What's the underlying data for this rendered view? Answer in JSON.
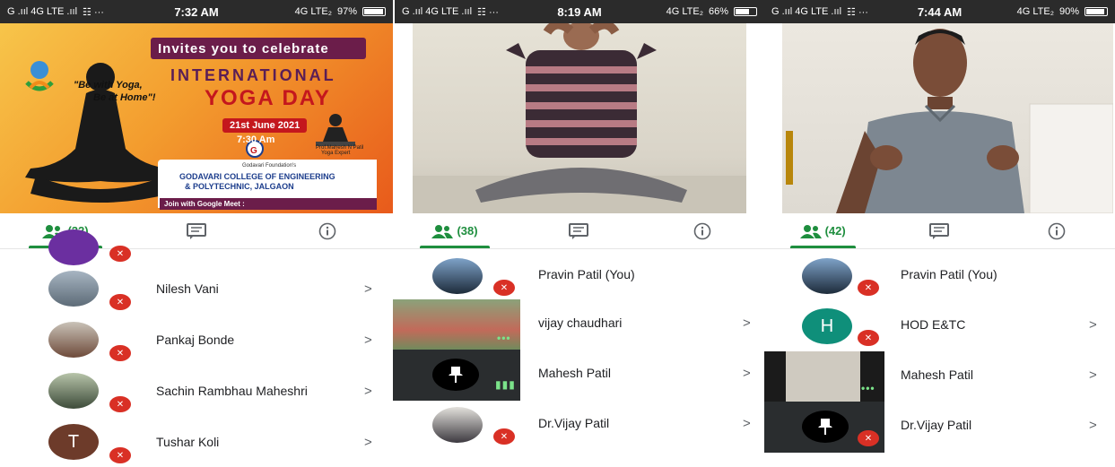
{
  "screens": [
    {
      "status": {
        "signal": "G .ııl 4G LTE .ııl",
        "icons": "☷ ···",
        "time": "7:32 AM",
        "network": "4G LTE₂",
        "battery": "97%",
        "battery_level": 0.97
      },
      "poster": {
        "invites": "Invites you to celebrate",
        "quote_line1": "\"Be with Yoga,",
        "quote_line2": "Be at Home\"!",
        "title_line1": "INTERNATIONAL",
        "title_line2": "YOGA DAY",
        "date": "21st June 2021",
        "time": "7:30 Am",
        "speaker_name": "Prof.Mahesh N Patil",
        "speaker_role": "Yoga Expert",
        "foundation": "Godavari Foundation's",
        "college_line1": "GODAVARI COLLEGE OF ENGINEERING",
        "college_line2": "& POLYTECHNIC, JALGAON",
        "meet": "Join with Google Meet :"
      },
      "tabs": {
        "people_count": "(22)"
      },
      "participants": [
        {
          "name": "Nilesh Vani"
        },
        {
          "name": "Pankaj Bonde"
        },
        {
          "name": "Sachin Rambhau Maheshri"
        },
        {
          "name": "Tushar Koli",
          "initial": "T"
        }
      ]
    },
    {
      "status": {
        "signal": "G .ııl 4G LTE .ııl",
        "icons": "☷ ···",
        "time": "8:19 AM",
        "network": "4G LTE₂",
        "battery": "66%",
        "battery_level": 0.66
      },
      "tabs": {
        "people_count": "(38)"
      },
      "participants": [
        {
          "name": "Pravin Patil (You)"
        },
        {
          "name": "vijay chaudhari"
        },
        {
          "name": "Mahesh Patil"
        },
        {
          "name": "Dr.Vijay Patil"
        }
      ]
    },
    {
      "status": {
        "signal": "G .ııl 4G LTE .ııl",
        "icons": "☷ ···",
        "time": "7:44 AM",
        "network": "4G LTE₂",
        "battery": "90%",
        "battery_level": 0.9
      },
      "tabs": {
        "people_count": "(42)"
      },
      "participants": [
        {
          "name": "Pravin Patil (You)"
        },
        {
          "name": "HOD E&TC",
          "initial": "H"
        },
        {
          "name": "Mahesh Patil"
        },
        {
          "name": "Dr.Vijay Patil"
        }
      ]
    }
  ],
  "colors": {
    "accent": "#1e8e3e",
    "mute": "#d93025",
    "hod_avatar": "#0f8f7a",
    "tushar_avatar": "#6d3b2a"
  },
  "icons": {
    "people": "people-icon",
    "chat": "chat-icon",
    "info": "info-icon",
    "mute": "mic-off-icon",
    "pin": "pin-icon",
    "chevron": "chevron-right-icon"
  }
}
